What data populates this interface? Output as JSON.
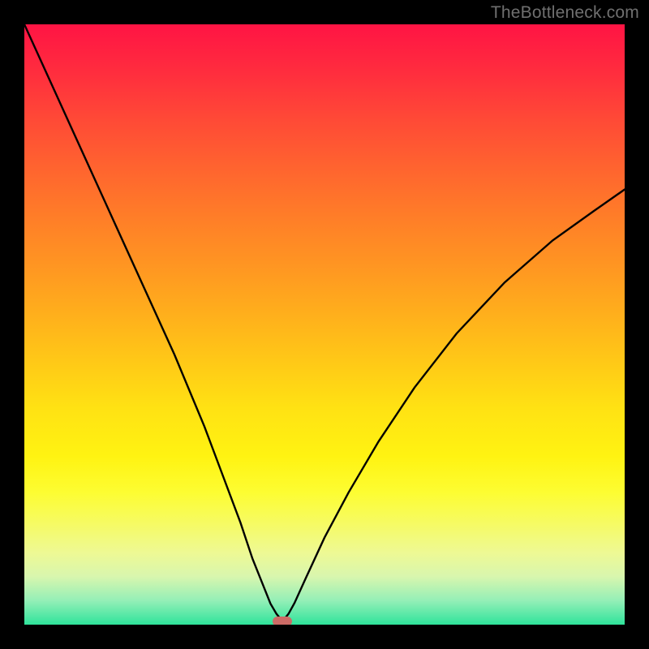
{
  "watermark": "TheBottleneck.com",
  "chart_data": {
    "type": "line",
    "title": "",
    "xlabel": "",
    "ylabel": "",
    "xlim": [
      0,
      100
    ],
    "ylim": [
      0,
      100
    ],
    "grid": false,
    "legend": false,
    "series": [
      {
        "name": "left-branch",
        "x": [
          0,
          5,
          10,
          15,
          20,
          25,
          30,
          33,
          36,
          38,
          40,
          41,
          42,
          42.8
        ],
        "y": [
          100,
          89,
          78,
          67,
          56,
          45,
          33,
          25,
          17,
          11,
          6,
          3.5,
          1.8,
          0.8
        ]
      },
      {
        "name": "right-branch",
        "x": [
          43.2,
          44,
          45,
          47,
          50,
          54,
          59,
          65,
          72,
          80,
          88,
          95,
          100
        ],
        "y": [
          0.8,
          1.8,
          3.6,
          8,
          14.5,
          22,
          30.5,
          39.5,
          48.5,
          57,
          64,
          69,
          72.5
        ]
      }
    ],
    "marker": {
      "x": 43,
      "y": 0.5,
      "name": "optimal-point"
    },
    "background": {
      "type": "vertical-gradient",
      "stops": [
        {
          "pos": 0,
          "color": "#ff1444"
        },
        {
          "pos": 50,
          "color": "#ffc817"
        },
        {
          "pos": 80,
          "color": "#fdfd32"
        },
        {
          "pos": 100,
          "color": "#2fe39b"
        }
      ]
    }
  }
}
